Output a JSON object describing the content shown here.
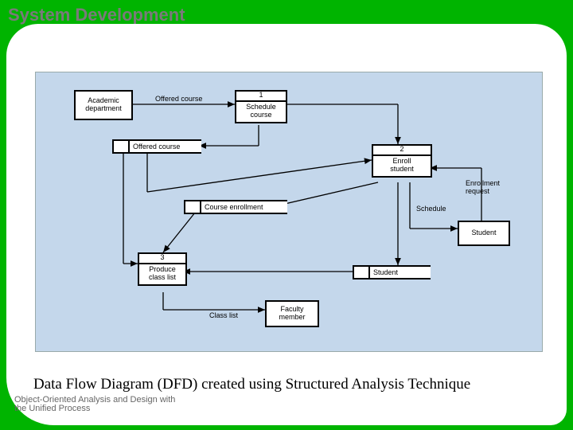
{
  "slide": {
    "title": "System Development",
    "caption": "Data Flow Diagram (DFD) created using Structured Analysis Technique",
    "foot1": "Object-Oriented Analysis and Design with",
    "foot2": "the Unified Process"
  },
  "dfd": {
    "externals": {
      "academic_dept": "Academic\ndepartment",
      "student": "Student",
      "faculty": "Faculty\nmember"
    },
    "processes": {
      "p1_num": "1",
      "p1_label": "Schedule\ncourse",
      "p2_num": "2",
      "p2_label": "Enroll\nstudent",
      "p3_num": "3",
      "p3_label": "Produce\nclass list"
    },
    "stores": {
      "offered_course": "Offered course",
      "course_enrollment": "Course enrollment",
      "student_store": "Student"
    },
    "flows": {
      "offered_course_flow": "Offered course",
      "enrollment_request": "Enrollment\nrequest",
      "schedule": "Schedule",
      "class_list": "Class list"
    }
  }
}
